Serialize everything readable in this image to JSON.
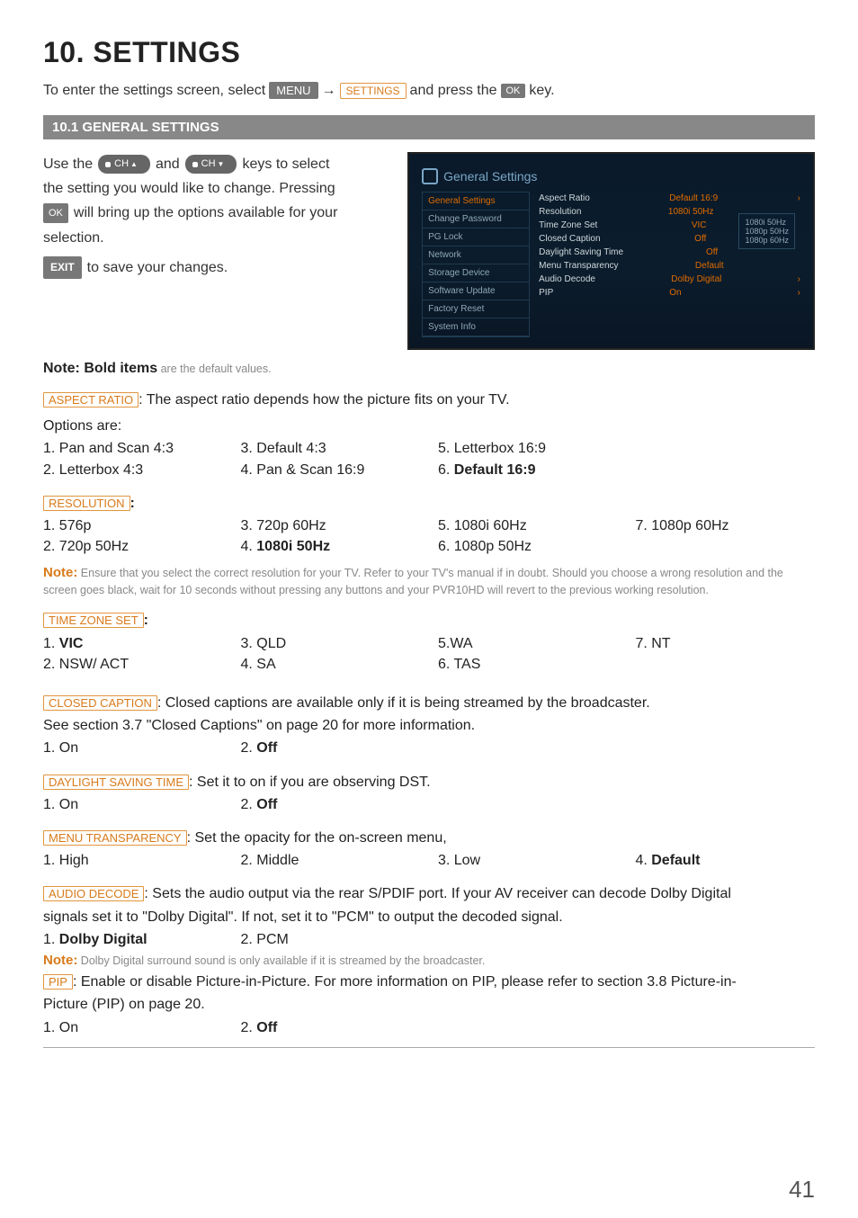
{
  "heading": "10. SETTINGS",
  "intro": {
    "p1": "To enter the settings screen, select",
    "menu": "MENU",
    "arrow": "→",
    "settings": "SETTINGS",
    "p2": "and press the",
    "ok": "OK",
    "p3": "key."
  },
  "section_bar": "10.1 GENERAL SETTINGS",
  "left": {
    "l1a": "Use the",
    "ch_up": "CH",
    "l1b": "and",
    "ch_dn": "CH",
    "l1c": "keys to select",
    "l2": "the setting you would like to change. Pressing",
    "ok": "OK",
    "l3": "will bring up the options available for your",
    "l4": "selection.",
    "exit": "EXIT",
    "l5": "to save your changes."
  },
  "tv": {
    "title": "General Settings",
    "sidebar": [
      "General Settings",
      "Change Password",
      "PG Lock",
      "Network",
      "Storage Device",
      "Software Update",
      "Factory Reset",
      "System Info"
    ],
    "rows": [
      {
        "k": "Aspect Ratio",
        "v": "Default 16:9",
        "a": "›"
      },
      {
        "k": "Resolution",
        "v": "1080i 50Hz",
        "a": ""
      },
      {
        "k": "Time Zone Set",
        "v": "VIC",
        "a": ""
      },
      {
        "k": "Closed Caption",
        "v": "Off",
        "a": ""
      },
      {
        "k": "Daylight Saving Time",
        "v": "Off",
        "a": ""
      },
      {
        "k": "Menu Transparency",
        "v": "Default",
        "a": ""
      },
      {
        "k": "Audio Decode",
        "v": "Dolby Digital",
        "a": "›"
      },
      {
        "k": "PIP",
        "v": "On",
        "a": "›"
      }
    ],
    "rbox": [
      "1080i 50Hz",
      "1080p 50Hz",
      "1080p 60Hz"
    ]
  },
  "note_bold": {
    "nb": "Note: Bold items",
    "rest": " are the default values."
  },
  "aspect": {
    "label": "ASPECT RATIO",
    "lead": ": The aspect ratio depends how the picture fits on your TV.",
    "opts_head": "Options are:",
    "c1a": "1. Pan and Scan 4:3",
    "c1b": "2. Letterbox 4:3",
    "c2a": "3. Default 4:3",
    "c2b": "4. Pan & Scan 16:9",
    "c3a": "5. Letterbox 16:9",
    "c3b_pre": "6. ",
    "c3b_bold": "Default 16:9"
  },
  "resolution": {
    "label": "RESOLUTION",
    "colon": ":",
    "c1a": "1. 576p",
    "c1b": "2. 720p 50Hz",
    "c2a": "3. 720p 60Hz",
    "c2b_pre": "4. ",
    "c2b_bold": "1080i 50Hz",
    "c3a": "5. 1080i 60Hz",
    "c3b": "6. 1080p 50Hz",
    "c4a": "7. 1080p 60Hz"
  },
  "res_note": {
    "nb": "Note:",
    "rest": " Ensure that you select the correct resolution for your TV. Refer to your TV's manual if in doubt. Should you choose a wrong resolution and the screen goes black, wait for 10 seconds without pressing any buttons and your PVR10HD will revert to the previous working resolution."
  },
  "tz": {
    "label": "TIME ZONE SET",
    "colon": ":",
    "c1a_pre": "1. ",
    "c1a_bold": "VIC",
    "c1b": "2. NSW/ ACT",
    "c2a": "3. QLD",
    "c2b": "4. SA",
    "c3a": "5.WA",
    "c3b": "6. TAS",
    "c4a": "7. NT"
  },
  "cc": {
    "label": "CLOSED CAPTION",
    "lead": ": Closed captions are available only if it is being streamed by the broadcaster.",
    "l2": "See section 3.7 \"Closed Captions\" on page 20 for more information.",
    "c1": "1. On",
    "c2_pre": "2. ",
    "c2_bold": "Off"
  },
  "dst": {
    "label": "DAYLIGHT SAVING TIME",
    "lead": ": Set it to on if you are observing DST.",
    "c1": "1. On",
    "c2_pre": "2. ",
    "c2_bold": "Off"
  },
  "mt": {
    "label": "MENU TRANSPARENCY",
    "lead": ": Set the opacity for the on-screen menu,",
    "c1": "1. High",
    "c2": "2. Middle",
    "c3": "3. Low",
    "c4_pre": "4. ",
    "c4_bold": "Default"
  },
  "ad": {
    "label": "AUDIO DECODE",
    "lead": ": Sets the audio output via the rear S/PDIF port. If your AV receiver can decode Dolby Digital",
    "l2": "signals set it to \"Dolby Digital\". If not, set it to \"PCM\" to output the decoded signal.",
    "c1_pre": "1. ",
    "c1_bold": "Dolby Digital",
    "c2": "2. PCM",
    "note_nb": "Note:",
    "note_rest": " Dolby Digital surround sound is only available if it is streamed by the broadcaster."
  },
  "pip": {
    "label": "PIP",
    "lead": ": Enable or disable Picture-in-Picture. For more information on PIP, please refer to section 3.8 Picture-in-",
    "l2": "Picture (PIP) on page 20.",
    "c1": "1. On",
    "c2_pre": "2. ",
    "c2_bold": "Off"
  },
  "pagenum": "41"
}
